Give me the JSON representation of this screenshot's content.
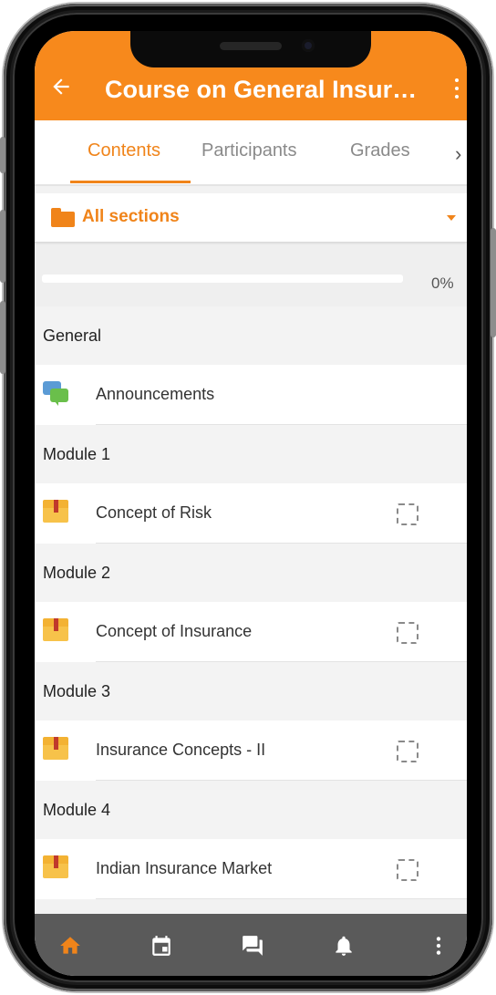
{
  "header": {
    "title": "Course on General Insurance",
    "back_icon": "arrow-left-icon",
    "menu_icon": "more-vertical-icon",
    "background": "#f7891c"
  },
  "tabs": [
    {
      "label": "Contents",
      "active": true
    },
    {
      "label": "Participants",
      "active": false
    },
    {
      "label": "Grades",
      "active": false
    }
  ],
  "tab_next_icon": "chevron-right-icon",
  "section_selector": {
    "label": "All sections",
    "icon": "folder-icon",
    "caret_icon": "caret-down-icon"
  },
  "progress": {
    "value": 0,
    "text": "0%"
  },
  "sections": [
    {
      "title": "General",
      "activities": [
        {
          "label": "Announcements",
          "icon": "forum-icon",
          "completion": false
        }
      ]
    },
    {
      "title": "Module 1",
      "activities": [
        {
          "label": "Concept of Risk",
          "icon": "box-icon",
          "completion": true
        }
      ]
    },
    {
      "title": "Module 2",
      "activities": [
        {
          "label": "Concept of Insurance",
          "icon": "box-icon",
          "completion": true
        }
      ]
    },
    {
      "title": "Module 3",
      "activities": [
        {
          "label": "Insurance Concepts - II",
          "icon": "box-icon",
          "completion": true
        }
      ]
    },
    {
      "title": "Module 4",
      "activities": [
        {
          "label": "Indian Insurance Market",
          "icon": "box-icon",
          "completion": true
        }
      ]
    }
  ],
  "bottom_nav": [
    {
      "icon": "home-icon",
      "active": true
    },
    {
      "icon": "calendar-icon",
      "active": false
    },
    {
      "icon": "messages-icon",
      "active": false
    },
    {
      "icon": "bell-icon",
      "active": false
    },
    {
      "icon": "more-vertical-icon",
      "active": false
    }
  ],
  "colors": {
    "accent": "#f0841a",
    "nav_background": "#5a5a5a",
    "nav_icon": "#ffffff"
  }
}
